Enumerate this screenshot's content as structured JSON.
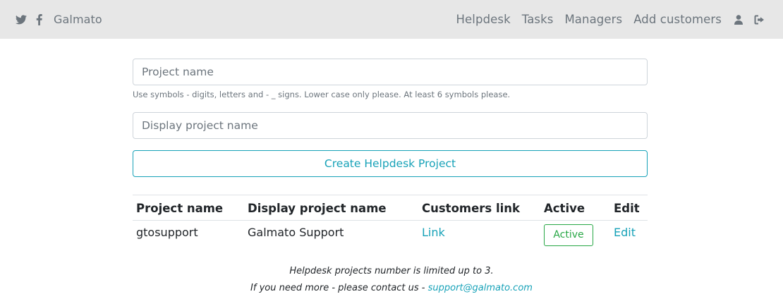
{
  "nav": {
    "brand": "Galmato",
    "links": [
      "Helpdesk",
      "Tasks",
      "Managers",
      "Add customers"
    ],
    "icons": [
      "twitter-icon",
      "facebook-icon",
      "user-icon",
      "logout-icon"
    ]
  },
  "form": {
    "project_name_placeholder": "Project name",
    "project_name_help": "Use symbols - digits, letters and - _ signs. Lower case only please. At least 6 symbols please.",
    "display_name_placeholder": "Display project name",
    "create_button": "Create Helpdesk Project"
  },
  "table": {
    "headers": [
      "Project name",
      "Display project name",
      "Customers link",
      "Active",
      "Edit"
    ],
    "rows": [
      {
        "project_name": "gtosupport",
        "display_name": "Galmato Support",
        "customers_link": "Link",
        "active": "Active",
        "edit": "Edit"
      }
    ]
  },
  "footer": {
    "limit_text": "Helpdesk projects number is limited up to 3.",
    "contact_text": "If you need more - please contact us - ",
    "contact_email": "support@galmato.com"
  },
  "colors": {
    "accent": "#17a2b8",
    "success": "#28a745",
    "navbar_bg": "#e7e7e7",
    "muted": "#6c757d"
  }
}
